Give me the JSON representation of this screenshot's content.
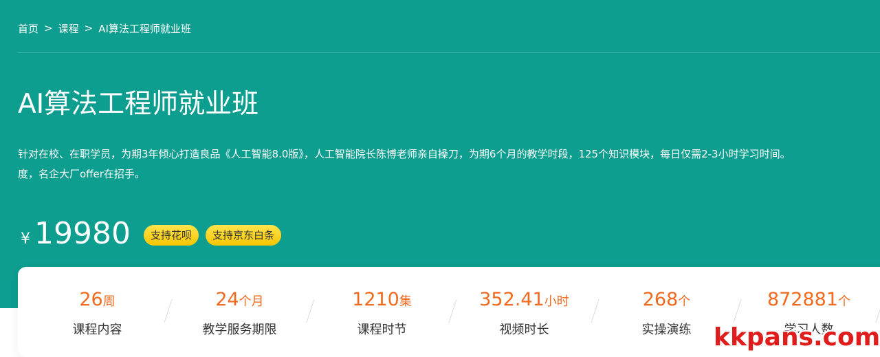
{
  "breadcrumb": {
    "home": "首页",
    "sep1": ">",
    "courses": "课程",
    "sep2": ">",
    "current": "AI算法工程师就业班"
  },
  "title": "AI算法工程师就业班",
  "description": {
    "line1": "针对在校、在职学员，为期3年倾心打造良品《人工智能8.0版》，人工智能院长陈博老师亲自操刀，为期6个月的教学时段，125个知识模块，每日仅需2-3小时学习时间。",
    "line2": "度，名企大厂offer在招手。"
  },
  "price": {
    "currency": "¥",
    "amount": "19980"
  },
  "badges": [
    "支持花呗",
    "支持京东白条"
  ],
  "stats": [
    {
      "value": "26",
      "unit": "周",
      "label": "课程内容"
    },
    {
      "value": "24",
      "unit": "个月",
      "label": "教学服务期限"
    },
    {
      "value": "1210",
      "unit": "集",
      "label": "课程时节"
    },
    {
      "value": "352.41",
      "unit": "小时",
      "label": "视频时长"
    },
    {
      "value": "268",
      "unit": "个",
      "label": "实操演练"
    },
    {
      "value": "872881",
      "unit": "个",
      "label": "学习人数"
    }
  ],
  "watermark": "kkpans.com",
  "colors": {
    "hero_bg": "#0d9e90",
    "stat_value": "#f06a1f",
    "badge_bg": "#fcd60f",
    "watermark": "#e01c1c"
  }
}
